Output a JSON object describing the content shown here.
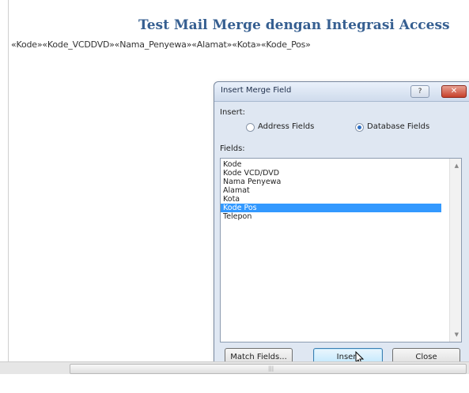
{
  "document": {
    "title": "Test Mail Merge dengan Integrasi Access",
    "merge_line": "«Kode»«Kode_VCDDVD»«Nama_Penyewa»«Alamat»«Kota»«Kode_Pos»"
  },
  "dialog": {
    "title": "Insert Merge Field",
    "help_label": "?",
    "close_label": "✕",
    "insert_label": "Insert:",
    "radio_address": "Address Fields",
    "radio_database": "Database Fields",
    "fields_label": "Fields:",
    "fields": [
      "Kode",
      "Kode VCD/DVD",
      "Nama Penyewa",
      "Alamat",
      "Kota",
      "Kode Pos",
      "Telepon"
    ],
    "selected_field": "Kode Pos",
    "buttons": {
      "match_fields": "Match Fields...",
      "insert": "Insert",
      "close": "Close"
    }
  },
  "scroll": {
    "up_arrow": "▲",
    "down_arrow": "▼",
    "grip": "|||"
  }
}
